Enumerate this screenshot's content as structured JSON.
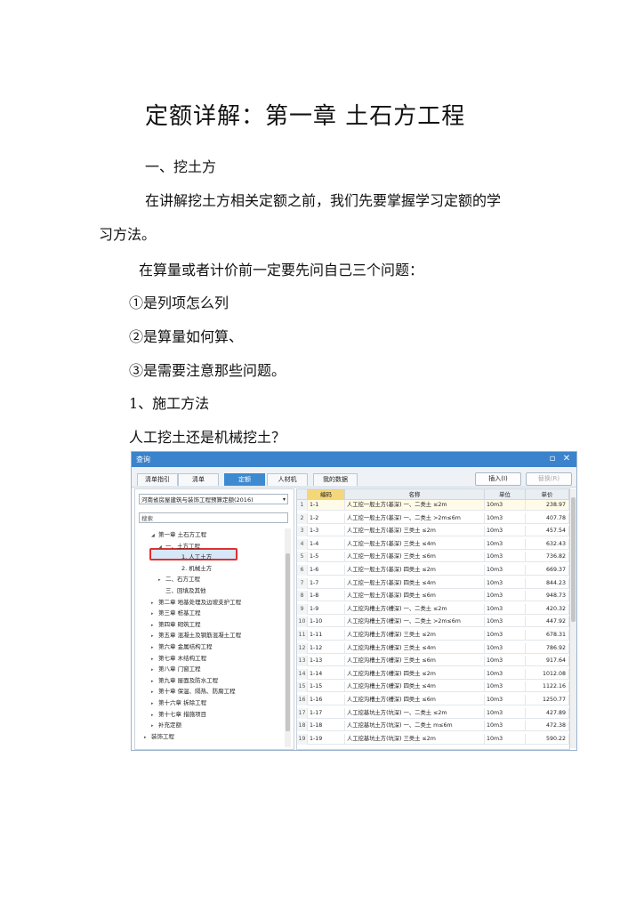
{
  "doc": {
    "title": "定额详解：第一章 土石方工程",
    "heading1": "一、挖土方",
    "para1_line1": "在讲解挖土方相关定额之前，我们先要掌握学习定额的学",
    "para1_line2": "习方法。",
    "para2": "在算量或者计价前一定要先问自己三个问题：",
    "q1": "①是列项怎么列",
    "q2": "②是算量如何算、",
    "q3": "③是需要注意那些问题。",
    "sub1": "1、施工方法",
    "question": "人工挖土还是机械挖土？"
  },
  "window": {
    "title": "查询",
    "tabs": [
      "清单指引",
      "清单",
      "定额",
      "人材机",
      "我的数据"
    ],
    "active_tab": "定额",
    "insert_button": "插入(I)",
    "replace_button": "替换(R)",
    "quota_library": "河南省房屋建筑与装饰工程预算定额(2016)",
    "search_placeholder": "搜索",
    "tree": [
      {
        "label": "第一章 土石方工程",
        "arrow": "◢"
      },
      {
        "label": "一、土方工程",
        "arrow": "◢"
      },
      {
        "label": "1. 人工土方",
        "arrow": ""
      },
      {
        "label": "2. 机械土方",
        "arrow": ""
      },
      {
        "label": "二、石方工程",
        "arrow": "▸"
      },
      {
        "label": "三、回填及其他",
        "arrow": ""
      },
      {
        "label": "第二章 地基处理及边坡支护工程",
        "arrow": "▸"
      },
      {
        "label": "第三章 桩基工程",
        "arrow": "▸"
      },
      {
        "label": "第四章 砌筑工程",
        "arrow": "▸"
      },
      {
        "label": "第五章 混凝土及钢筋混凝土工程",
        "arrow": "▸"
      },
      {
        "label": "第六章 金属结构工程",
        "arrow": "▸"
      },
      {
        "label": "第七章 木结构工程",
        "arrow": "▸"
      },
      {
        "label": "第八章 门窗工程",
        "arrow": "▸"
      },
      {
        "label": "第九章 屋面及防水工程",
        "arrow": "▸"
      },
      {
        "label": "第十章 保温、隔热、防腐工程",
        "arrow": "▸"
      },
      {
        "label": "第十六章 拆除工程",
        "arrow": "▸"
      },
      {
        "label": "第十七章 措施项目",
        "arrow": "▸"
      },
      {
        "label": "补充定额",
        "arrow": "▸"
      },
      {
        "label": "装饰工程",
        "arrow": "▸"
      }
    ],
    "columns": [
      "",
      "编码",
      "名称",
      "单位",
      "单价"
    ],
    "rows": [
      [
        "1",
        "1-1",
        "人工挖一般土方(基深) 一、二类土 ≤2m",
        "10m3",
        "238.97"
      ],
      [
        "2",
        "1-2",
        "人工挖一般土方(基深) 一、二类土 >2m≤6m",
        "10m3",
        "407.78"
      ],
      [
        "3",
        "1-3",
        "人工挖一般土方(基深) 三类土 ≤2m",
        "10m3",
        "457.54"
      ],
      [
        "4",
        "1-4",
        "人工挖一般土方(基深) 三类土 ≤4m",
        "10m3",
        "632.43"
      ],
      [
        "5",
        "1-5",
        "人工挖一般土方(基深) 三类土 ≤6m",
        "10m3",
        "736.82"
      ],
      [
        "6",
        "1-6",
        "人工挖一般土方(基深) 四类土 ≤2m",
        "10m3",
        "669.37"
      ],
      [
        "7",
        "1-7",
        "人工挖一般土方(基深) 四类土 ≤4m",
        "10m3",
        "844.23"
      ],
      [
        "8",
        "1-8",
        "人工挖一般土方(基深) 四类土 ≤6m",
        "10m3",
        "948.73"
      ],
      [
        "9",
        "1-9",
        "人工挖沟槽土方(槽深) 一、二类土 ≤2m",
        "10m3",
        "420.32"
      ],
      [
        "10",
        "1-10",
        "人工挖沟槽土方(槽深) 一、二类土 >2m≤6m",
        "10m3",
        "447.92"
      ],
      [
        "11",
        "1-11",
        "人工挖沟槽土方(槽深) 三类土 ≤2m",
        "10m3",
        "678.31"
      ],
      [
        "12",
        "1-12",
        "人工挖沟槽土方(槽深) 三类土 ≤4m",
        "10m3",
        "786.92"
      ],
      [
        "13",
        "1-13",
        "人工挖沟槽土方(槽深) 三类土 ≤6m",
        "10m3",
        "917.64"
      ],
      [
        "14",
        "1-14",
        "人工挖沟槽土方(槽深) 四类土 ≤2m",
        "10m3",
        "1012.08"
      ],
      [
        "15",
        "1-15",
        "人工挖沟槽土方(槽深) 四类土 ≤4m",
        "10m3",
        "1122.16"
      ],
      [
        "16",
        "1-16",
        "人工挖沟槽土方(槽深) 四类土 ≤6m",
        "10m3",
        "1250.77"
      ],
      [
        "17",
        "1-17",
        "人工挖基坑土方(坑深) 一、二类土 ≤2m",
        "10m3",
        "427.89"
      ],
      [
        "18",
        "1-18",
        "人工挖基坑土方(坑深) 一、二类土 m≤6m",
        "10m3",
        "472.38"
      ],
      [
        "19",
        "1-19",
        "人工挖基坑土方(坑深) 三类土 ≤2m",
        "10m3",
        "590.22"
      ]
    ]
  }
}
